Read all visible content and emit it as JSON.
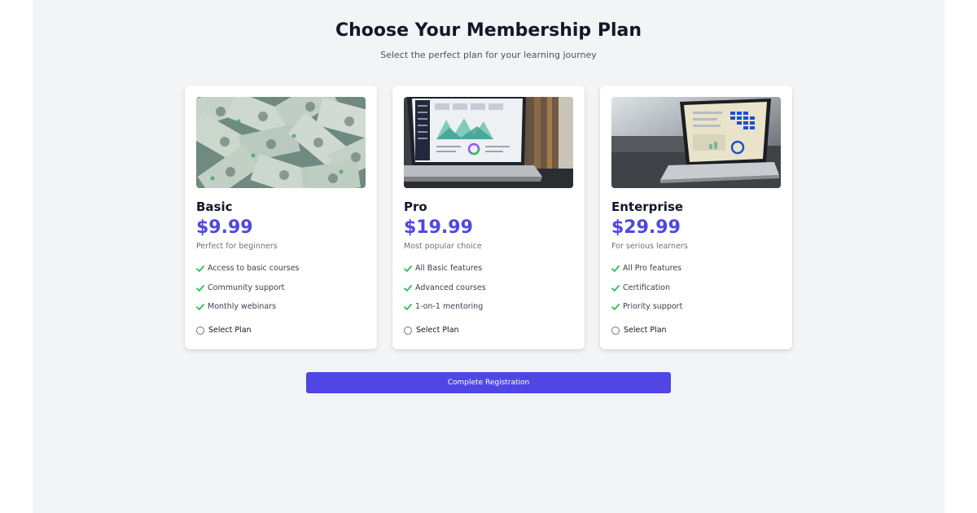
{
  "header": {
    "title": "Choose Your Membership Plan",
    "subtitle": "Select the perfect plan for your learning journey"
  },
  "plans": [
    {
      "name": "Basic",
      "price": "$9.99",
      "description": "Perfect for beginners",
      "features": [
        "Access to basic courses",
        "Community support",
        "Monthly webinars"
      ],
      "select_label": "Select Plan",
      "image": "money-photo"
    },
    {
      "name": "Pro",
      "price": "$19.99",
      "description": "Most popular choice",
      "features": [
        "All Basic features",
        "Advanced courses",
        "1-on-1 mentoring"
      ],
      "select_label": "Select Plan",
      "image": "laptop-dashboard-photo"
    },
    {
      "name": "Enterprise",
      "price": "$29.99",
      "description": "For serious learners",
      "features": [
        "All Pro features",
        "Certification",
        "Priority support"
      ],
      "select_label": "Select Plan",
      "image": "laptop-analytics-photo"
    }
  ],
  "submit": {
    "label": "Complete Registration"
  },
  "colors": {
    "accent": "#4f46e5",
    "check": "#22c55e",
    "page_bg": "#f3f4f6",
    "card_bg": "#ffffff"
  },
  "icons": {
    "feature": "check-icon",
    "select": "radio-icon"
  }
}
